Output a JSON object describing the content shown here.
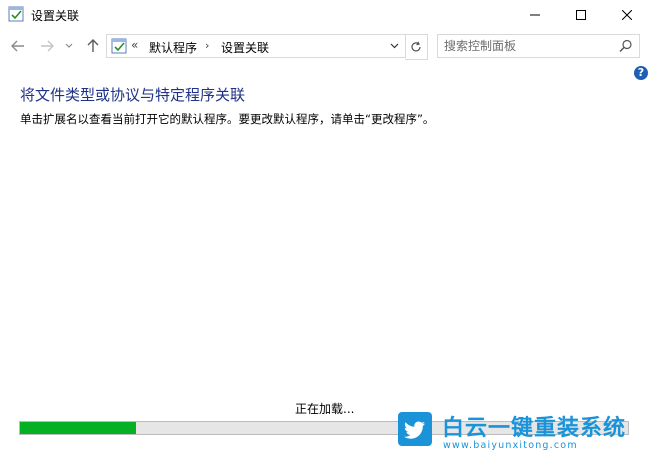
{
  "window": {
    "title": "设置关联"
  },
  "navigation": {
    "address": {
      "overflow_chevrons": "«",
      "breadcrumbs": [
        "默认程序",
        "设置关联"
      ],
      "separator": "›"
    },
    "search": {
      "placeholder": "搜索控制面板"
    }
  },
  "help_label": "?",
  "main": {
    "heading": "将文件类型或协议与特定程序关联",
    "description": "单击扩展名以查看当前打开它的默认程序。要更改默认程序，请单击“更改程序”。"
  },
  "loading": {
    "text": "正在加载...",
    "progress_percent": 19
  },
  "watermark": {
    "title": "白云一键重装系统",
    "url": "www.baiyunxitong.com"
  },
  "colors": {
    "heading": "#1e3287",
    "progress": "#06b025",
    "watermark": "#1a93d8",
    "help": "#1e5fb4"
  }
}
